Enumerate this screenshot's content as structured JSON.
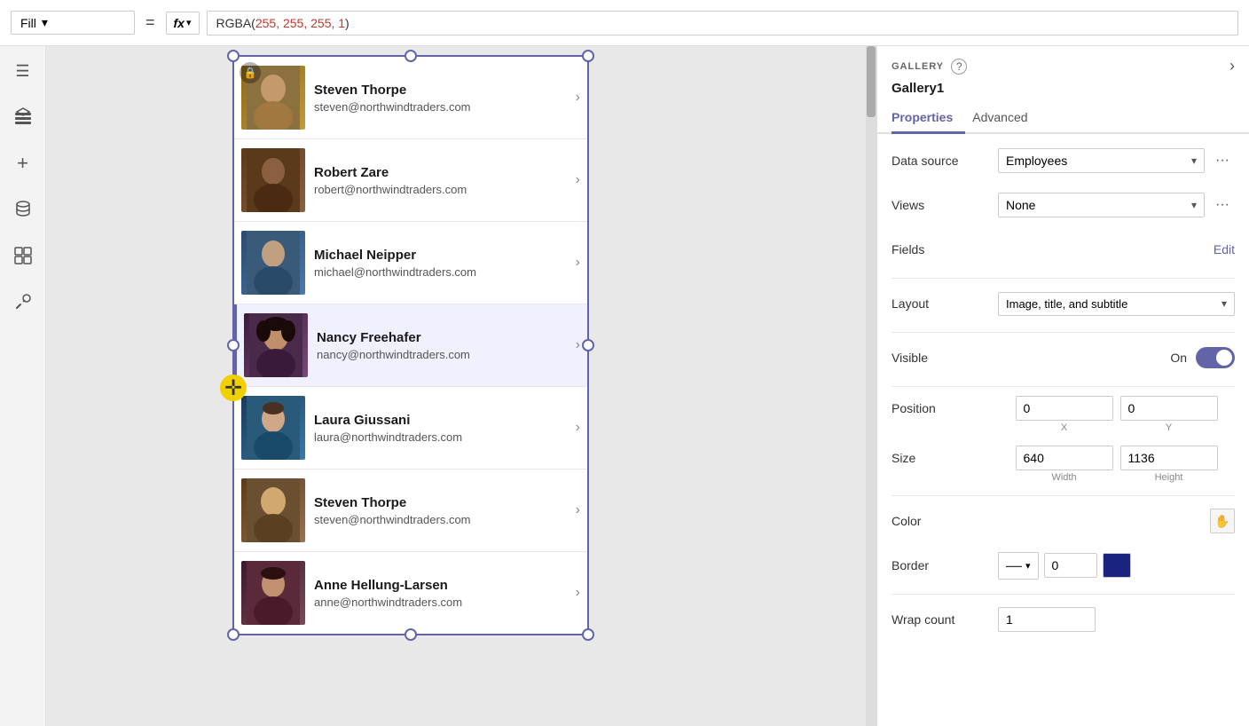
{
  "topbar": {
    "fill_label": "Fill",
    "equals_sign": "=",
    "fx_label": "fx",
    "formula_value": "RGBA(255, 255, 255, 1)",
    "formula_prefix": "RGBA(",
    "formula_args": "255, 255, 255, 1",
    "formula_suffix": ")"
  },
  "sidebar": {
    "icons": [
      {
        "name": "hamburger-icon",
        "glyph": "☰"
      },
      {
        "name": "layers-icon",
        "glyph": "⊞"
      },
      {
        "name": "add-icon",
        "glyph": "+"
      },
      {
        "name": "database-icon",
        "glyph": "⬡"
      },
      {
        "name": "components-icon",
        "glyph": "⊡"
      },
      {
        "name": "tools-icon",
        "glyph": "⚙"
      }
    ]
  },
  "gallery": {
    "items": [
      {
        "name": "Steven Thorpe",
        "email": "steven@northwindtraders.com",
        "avatar_class": "avatar-steven1",
        "avatar_char": "👤"
      },
      {
        "name": "Robert Zare",
        "email": "robert@northwindtraders.com",
        "avatar_class": "avatar-robert",
        "avatar_char": "👤"
      },
      {
        "name": "Michael Neipper",
        "email": "michael@northwindtraders.com",
        "avatar_class": "avatar-michael",
        "avatar_char": "👤"
      },
      {
        "name": "Nancy Freehafer",
        "email": "nancy@northwindtraders.com",
        "avatar_class": "avatar-nancy",
        "avatar_char": "👤",
        "active": true
      },
      {
        "name": "Laura Giussani",
        "email": "laura@northwindtraders.com",
        "avatar_class": "avatar-laura",
        "avatar_char": "👤"
      },
      {
        "name": "Steven Thorpe",
        "email": "steven@northwindtraders.com",
        "avatar_class": "avatar-steven2",
        "avatar_char": "👤"
      },
      {
        "name": "Anne Hellung-Larsen",
        "email": "anne@northwindtraders.com",
        "avatar_class": "avatar-anne",
        "avatar_char": "👤"
      }
    ]
  },
  "panel": {
    "section_title": "GALLERY",
    "help_icon": "?",
    "forward_icon": "›",
    "gallery_name": "Gallery1",
    "tabs": [
      {
        "label": "Properties",
        "active": true
      },
      {
        "label": "Advanced",
        "active": false
      }
    ],
    "properties": {
      "data_source_label": "Data source",
      "data_source_value": "Employees",
      "views_label": "Views",
      "views_value": "None",
      "fields_label": "Fields",
      "fields_edit": "Edit",
      "layout_label": "Layout",
      "layout_value": "Image, title, and subtitle",
      "visible_label": "Visible",
      "visible_on": "On",
      "position_label": "Position",
      "position_x": "0",
      "position_y": "0",
      "position_x_label": "X",
      "position_y_label": "Y",
      "size_label": "Size",
      "size_width": "640",
      "size_height": "1136",
      "size_width_label": "Width",
      "size_height_label": "Height",
      "color_label": "Color",
      "color_icon": "✋",
      "border_label": "Border",
      "border_width": "0",
      "wrap_count_label": "Wrap count",
      "wrap_count_value": "1"
    }
  }
}
